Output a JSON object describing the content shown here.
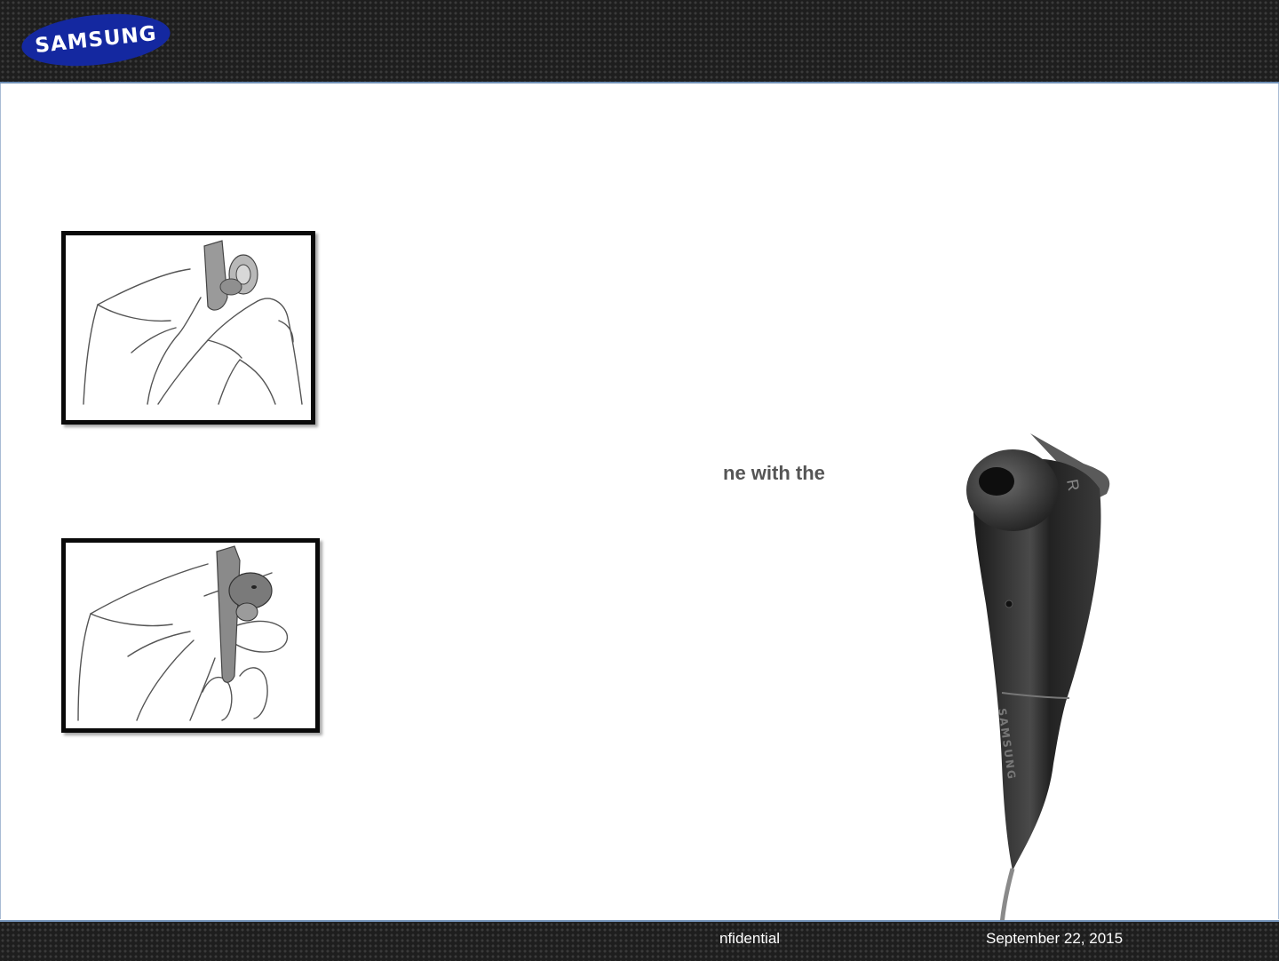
{
  "header": {
    "logo_text": "SAMSUNG",
    "logo_color": "#1428a0"
  },
  "slide": {
    "step_text": "ne with the"
  },
  "earbud": {
    "side_mark": "R",
    "brand_print": "SAMSUNG"
  },
  "footer": {
    "confidential": "nfidential",
    "date": "September 22, 2015"
  }
}
